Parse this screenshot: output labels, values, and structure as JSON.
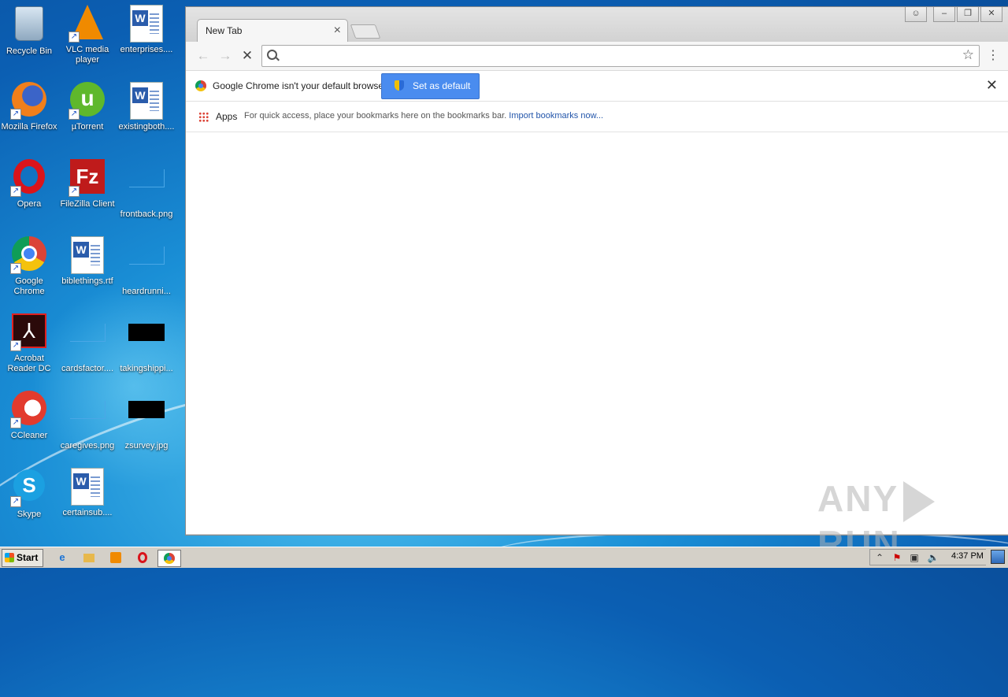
{
  "desktop": {
    "icons": [
      {
        "label": "Recycle Bin"
      },
      {
        "label": "VLC media player"
      },
      {
        "label": "enterprises...."
      },
      {
        "label": "Mozilla Firefox"
      },
      {
        "label": "µTorrent"
      },
      {
        "label": "existingboth...."
      },
      {
        "label": "Opera"
      },
      {
        "label": "FileZilla Client"
      },
      {
        "label": "frontback.png"
      },
      {
        "label": "Google Chrome"
      },
      {
        "label": "biblethings.rtf"
      },
      {
        "label": "heardrunni..."
      },
      {
        "label": "Acrobat Reader DC"
      },
      {
        "label": "cardsfactor...."
      },
      {
        "label": "takingshippi..."
      },
      {
        "label": "CCleaner"
      },
      {
        "label": "caregives.png"
      },
      {
        "label": "zsurvey.jpg"
      },
      {
        "label": "Skype"
      },
      {
        "label": "certainsub...."
      }
    ]
  },
  "browser": {
    "tab_title": "New Tab",
    "omnibox_value": "",
    "infobar_message": "Google Chrome isn't your default browser.",
    "set_default_label": "Set as default",
    "apps_label": "Apps",
    "bookmarks_message": "For quick access, place your bookmarks here on the bookmarks bar.",
    "import_link": "Import bookmarks now..."
  },
  "watermark": {
    "left": "ANY",
    "right": "RUN"
  },
  "taskbar": {
    "start_label": "Start",
    "clock": "4:37 PM"
  },
  "colors": {
    "accent": "#4a8cef",
    "link": "#2255aa"
  }
}
